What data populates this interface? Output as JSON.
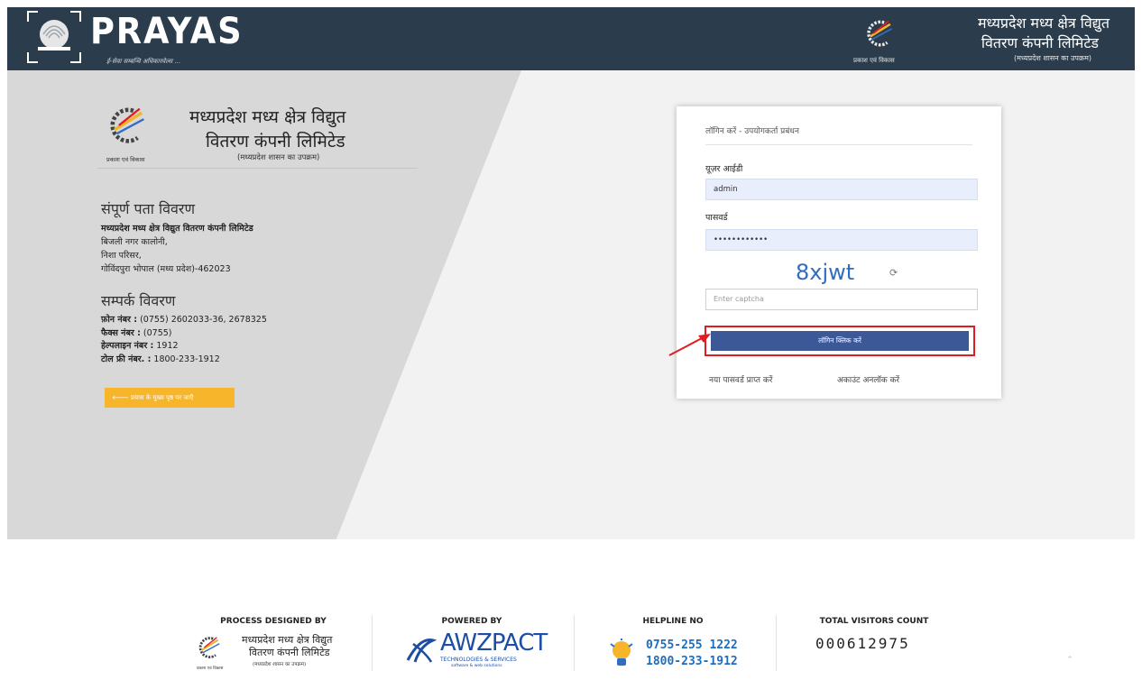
{
  "header": {
    "brand": "PRAYAS",
    "tagline": "ई-सेवा सम्बन्धि अधिकारवेल्स ...",
    "org_line1": "मध्यप्रदेश मध्य क्षेत्र विद्युत",
    "org_line2": "वितरण कंपनी लिमिटेड",
    "org_line3": "(मध्यप्रदेश शासन का उपक्रम)",
    "org_tag": "प्रकाश एवं विकास"
  },
  "left": {
    "org_line1": "मध्यप्रदेश मध्य क्षेत्र विद्युत",
    "org_line2": "वितरण कंपनी लिमिटेड",
    "org_line3": "(मध्यप्रदेश शासन का उपक्रम)",
    "org_tag": "प्रकाश एवं विकास",
    "address_title": "संपूर्ण पता विवरण",
    "address_company": "मध्यप्रदेश मध्य क्षेत्र विद्युत वितरण कंपनी लिमिटेड",
    "address_line1": "बिजली नगर कालोनी,",
    "address_line2": "निशा परिसर,",
    "address_line3": "गोविंदपुरा भोपाल (मध्य प्रदेश)-462023",
    "contact_title": "सम्पर्क विवरण",
    "phone_label": "फ़ोन नंबर :",
    "phone_value": " (0755) 2602033-36, 2678325",
    "fax_label": "फैक्स नंबर :",
    "fax_value": " (0755)",
    "helpline_label": "हेल्पलाइन नंबर :",
    "helpline_value": " 1912",
    "tollfree_label": "टोल फ्री नंबर. :",
    "tollfree_value": " 1800-233-1912",
    "back_button": "🡐  प्रयास के मुख्य पृष्ठ पर जाएँ"
  },
  "login": {
    "title": "लॉगिन करें - उपयोगकर्ता प्रबंधन",
    "user_label": "यूज़र आईडी",
    "user_value": "admin",
    "password_label": "पासवर्ड",
    "password_value": "••••••••••••",
    "captcha": "8xjwt",
    "captcha_placeholder": "Enter captcha",
    "login_button": "लॉगिन क्लिक करें",
    "forgot_link": "नया पासवर्ड प्राप्त करें",
    "unlock_link": "अकाउंट अनलॉक करें"
  },
  "footer": {
    "designed_by_head": "PROCESS DESIGNED BY",
    "designed_by_l1": "मध्यप्रदेश मध्य क्षेत्र विद्युत",
    "designed_by_l2": "वितरण कंपनी लिमिटेड",
    "designed_by_l3": "(मध्यप्रदेश शासन का उपक्रम)",
    "designed_by_tag": "प्रकाश एवं विकास",
    "powered_by_head": "POWERED BY",
    "powered_by_name": "AWZPACT",
    "powered_by_sub": "TECHNOLOGIES & SERVICES",
    "powered_by_tag": "software & web solutions",
    "helpline_head": "HELPLINE NO",
    "helpline_1": "0755-255 1222",
    "helpline_2": "1800-233-1912",
    "visitors_head": "TOTAL VISITORS COUNT",
    "visitors_count": "000612975",
    "scroll_top": "^"
  },
  "colors": {
    "header_bg": "#2b3d4d",
    "login_button": "#3c5896",
    "highlight_box": "#e01b22",
    "back_button": "#f7b52b",
    "captcha": "#2f6ec4"
  }
}
